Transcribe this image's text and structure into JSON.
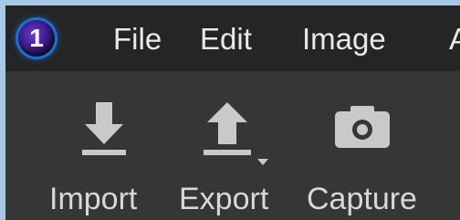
{
  "app": {
    "logo_glyph": "1"
  },
  "menubar": {
    "items": [
      {
        "label": "File"
      },
      {
        "label": "Edit"
      },
      {
        "label": "Image"
      },
      {
        "label": "A"
      }
    ]
  },
  "toolbar": {
    "tools": [
      {
        "label": "Import",
        "icon": "import-icon"
      },
      {
        "label": "Export",
        "icon": "export-icon",
        "has_dropdown": true
      },
      {
        "label": "Capture",
        "icon": "camera-icon"
      }
    ]
  },
  "colors": {
    "menubar_bg": "#252525",
    "toolbar_bg": "#363636",
    "icon": "#c9c9c9",
    "text": "#e0e0e0",
    "logo_ring": "#1b6fd8"
  }
}
